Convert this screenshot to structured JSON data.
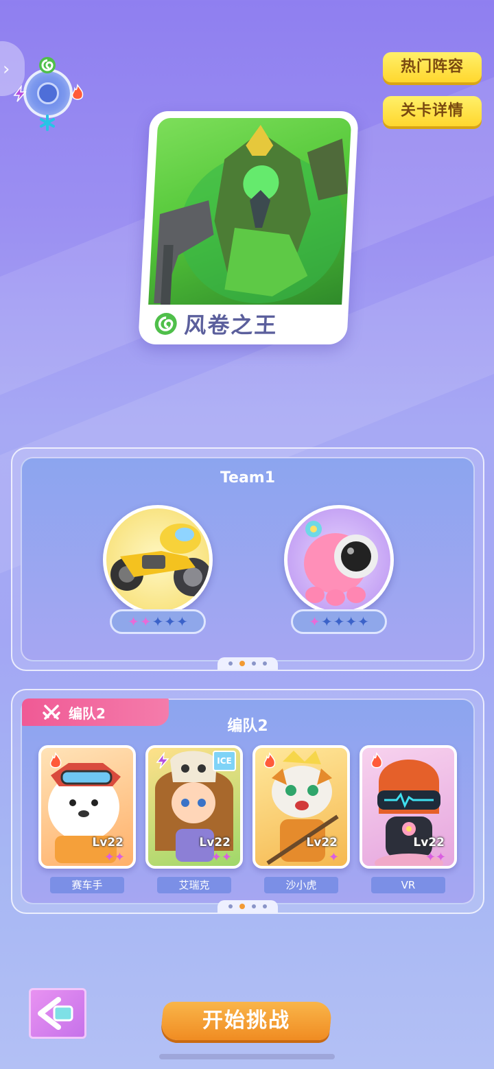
{
  "top_buttons": {
    "lineup": "热门阵容",
    "stage_details": "关卡详情"
  },
  "boss": {
    "name": "风卷之王",
    "element_icon": "wind-icon"
  },
  "team_panel": {
    "title": "Team1",
    "pets": [
      {
        "name": "motorbike",
        "stars_on": 2,
        "stars_total": 5
      },
      {
        "name": "pink-octopus-speaker",
        "stars_on": 1,
        "stars_total": 5
      }
    ],
    "pager": {
      "count": 4,
      "active": 1
    }
  },
  "formation_panel": {
    "tab_label": "编队2",
    "title": "编队2",
    "heroes": [
      {
        "name": "赛车手",
        "level": "Lv22",
        "element": "fire-icon",
        "stars": "✦✦"
      },
      {
        "name": "艾瑞克",
        "level": "Lv22",
        "element": "lightning-icon",
        "stars": "✦✦",
        "badge": "ICE"
      },
      {
        "name": "沙小虎",
        "level": "Lv22",
        "element": "fire-icon",
        "stars": "✦"
      },
      {
        "name": "VR",
        "level": "Lv22",
        "element": "fire-icon",
        "stars": "✦✦"
      }
    ],
    "pager": {
      "count": 4,
      "active": 1
    }
  },
  "start_button": "开始挑战",
  "colors": {
    "accent_yellow": "#ffd72e",
    "start_orange": "#f08c22",
    "tab_pink": "#f05a95"
  }
}
